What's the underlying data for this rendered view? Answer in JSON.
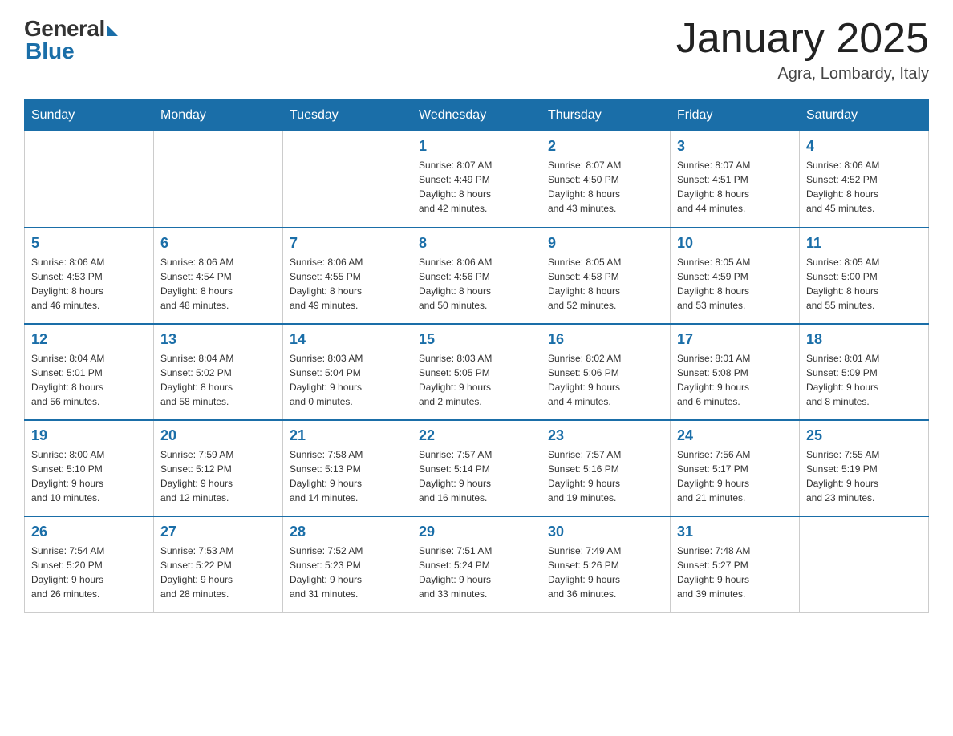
{
  "header": {
    "logo_general": "General",
    "logo_blue": "Blue",
    "month_title": "January 2025",
    "location": "Agra, Lombardy, Italy"
  },
  "days_of_week": [
    "Sunday",
    "Monday",
    "Tuesday",
    "Wednesday",
    "Thursday",
    "Friday",
    "Saturday"
  ],
  "weeks": [
    {
      "days": [
        {
          "number": "",
          "info": ""
        },
        {
          "number": "",
          "info": ""
        },
        {
          "number": "",
          "info": ""
        },
        {
          "number": "1",
          "info": "Sunrise: 8:07 AM\nSunset: 4:49 PM\nDaylight: 8 hours\nand 42 minutes."
        },
        {
          "number": "2",
          "info": "Sunrise: 8:07 AM\nSunset: 4:50 PM\nDaylight: 8 hours\nand 43 minutes."
        },
        {
          "number": "3",
          "info": "Sunrise: 8:07 AM\nSunset: 4:51 PM\nDaylight: 8 hours\nand 44 minutes."
        },
        {
          "number": "4",
          "info": "Sunrise: 8:06 AM\nSunset: 4:52 PM\nDaylight: 8 hours\nand 45 minutes."
        }
      ]
    },
    {
      "days": [
        {
          "number": "5",
          "info": "Sunrise: 8:06 AM\nSunset: 4:53 PM\nDaylight: 8 hours\nand 46 minutes."
        },
        {
          "number": "6",
          "info": "Sunrise: 8:06 AM\nSunset: 4:54 PM\nDaylight: 8 hours\nand 48 minutes."
        },
        {
          "number": "7",
          "info": "Sunrise: 8:06 AM\nSunset: 4:55 PM\nDaylight: 8 hours\nand 49 minutes."
        },
        {
          "number": "8",
          "info": "Sunrise: 8:06 AM\nSunset: 4:56 PM\nDaylight: 8 hours\nand 50 minutes."
        },
        {
          "number": "9",
          "info": "Sunrise: 8:05 AM\nSunset: 4:58 PM\nDaylight: 8 hours\nand 52 minutes."
        },
        {
          "number": "10",
          "info": "Sunrise: 8:05 AM\nSunset: 4:59 PM\nDaylight: 8 hours\nand 53 minutes."
        },
        {
          "number": "11",
          "info": "Sunrise: 8:05 AM\nSunset: 5:00 PM\nDaylight: 8 hours\nand 55 minutes."
        }
      ]
    },
    {
      "days": [
        {
          "number": "12",
          "info": "Sunrise: 8:04 AM\nSunset: 5:01 PM\nDaylight: 8 hours\nand 56 minutes."
        },
        {
          "number": "13",
          "info": "Sunrise: 8:04 AM\nSunset: 5:02 PM\nDaylight: 8 hours\nand 58 minutes."
        },
        {
          "number": "14",
          "info": "Sunrise: 8:03 AM\nSunset: 5:04 PM\nDaylight: 9 hours\nand 0 minutes."
        },
        {
          "number": "15",
          "info": "Sunrise: 8:03 AM\nSunset: 5:05 PM\nDaylight: 9 hours\nand 2 minutes."
        },
        {
          "number": "16",
          "info": "Sunrise: 8:02 AM\nSunset: 5:06 PM\nDaylight: 9 hours\nand 4 minutes."
        },
        {
          "number": "17",
          "info": "Sunrise: 8:01 AM\nSunset: 5:08 PM\nDaylight: 9 hours\nand 6 minutes."
        },
        {
          "number": "18",
          "info": "Sunrise: 8:01 AM\nSunset: 5:09 PM\nDaylight: 9 hours\nand 8 minutes."
        }
      ]
    },
    {
      "days": [
        {
          "number": "19",
          "info": "Sunrise: 8:00 AM\nSunset: 5:10 PM\nDaylight: 9 hours\nand 10 minutes."
        },
        {
          "number": "20",
          "info": "Sunrise: 7:59 AM\nSunset: 5:12 PM\nDaylight: 9 hours\nand 12 minutes."
        },
        {
          "number": "21",
          "info": "Sunrise: 7:58 AM\nSunset: 5:13 PM\nDaylight: 9 hours\nand 14 minutes."
        },
        {
          "number": "22",
          "info": "Sunrise: 7:57 AM\nSunset: 5:14 PM\nDaylight: 9 hours\nand 16 minutes."
        },
        {
          "number": "23",
          "info": "Sunrise: 7:57 AM\nSunset: 5:16 PM\nDaylight: 9 hours\nand 19 minutes."
        },
        {
          "number": "24",
          "info": "Sunrise: 7:56 AM\nSunset: 5:17 PM\nDaylight: 9 hours\nand 21 minutes."
        },
        {
          "number": "25",
          "info": "Sunrise: 7:55 AM\nSunset: 5:19 PM\nDaylight: 9 hours\nand 23 minutes."
        }
      ]
    },
    {
      "days": [
        {
          "number": "26",
          "info": "Sunrise: 7:54 AM\nSunset: 5:20 PM\nDaylight: 9 hours\nand 26 minutes."
        },
        {
          "number": "27",
          "info": "Sunrise: 7:53 AM\nSunset: 5:22 PM\nDaylight: 9 hours\nand 28 minutes."
        },
        {
          "number": "28",
          "info": "Sunrise: 7:52 AM\nSunset: 5:23 PM\nDaylight: 9 hours\nand 31 minutes."
        },
        {
          "number": "29",
          "info": "Sunrise: 7:51 AM\nSunset: 5:24 PM\nDaylight: 9 hours\nand 33 minutes."
        },
        {
          "number": "30",
          "info": "Sunrise: 7:49 AM\nSunset: 5:26 PM\nDaylight: 9 hours\nand 36 minutes."
        },
        {
          "number": "31",
          "info": "Sunrise: 7:48 AM\nSunset: 5:27 PM\nDaylight: 9 hours\nand 39 minutes."
        },
        {
          "number": "",
          "info": ""
        }
      ]
    }
  ]
}
